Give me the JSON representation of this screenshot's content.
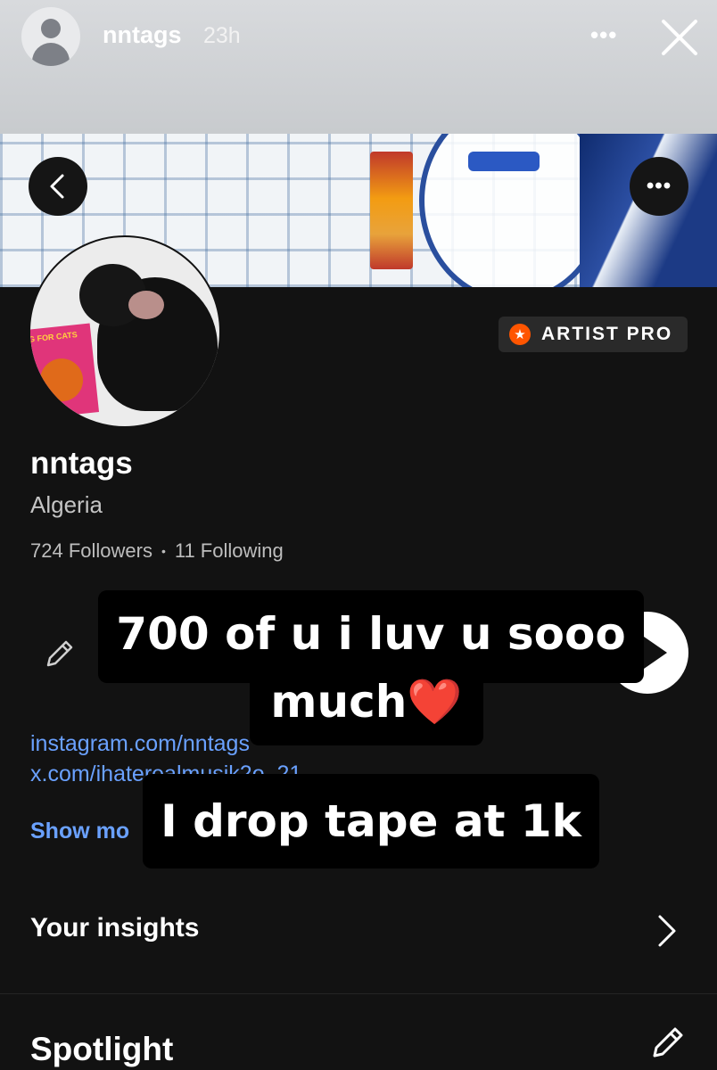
{
  "story": {
    "username": "nntags",
    "time": "23h",
    "more_label": "•••",
    "icons": {
      "avatar": "default-avatar-icon",
      "close": "close-icon"
    }
  },
  "banner": {
    "back_icon": "chevron-left-icon",
    "more_label": "•••"
  },
  "profile": {
    "username": "nntags",
    "location": "Algeria",
    "followers": "724 Followers",
    "separator": "•",
    "following": "11 Following",
    "badge": {
      "icon": "star-icon",
      "star_glyph": "★",
      "label": "ARTIST PRO",
      "color": "#ff5500"
    },
    "avatar_box_text": "G FOR CATS"
  },
  "links": [
    "instagram.com/nntags",
    "x.com/ihaterealmusik2o_21"
  ],
  "show_more": "Show mo",
  "captions": {
    "line1": "700 of u i luv u sooo",
    "line2": "much❤️",
    "line3": "I drop tape at 1k"
  },
  "sections": {
    "insights": "Your insights",
    "spotlight": "Spotlight"
  }
}
